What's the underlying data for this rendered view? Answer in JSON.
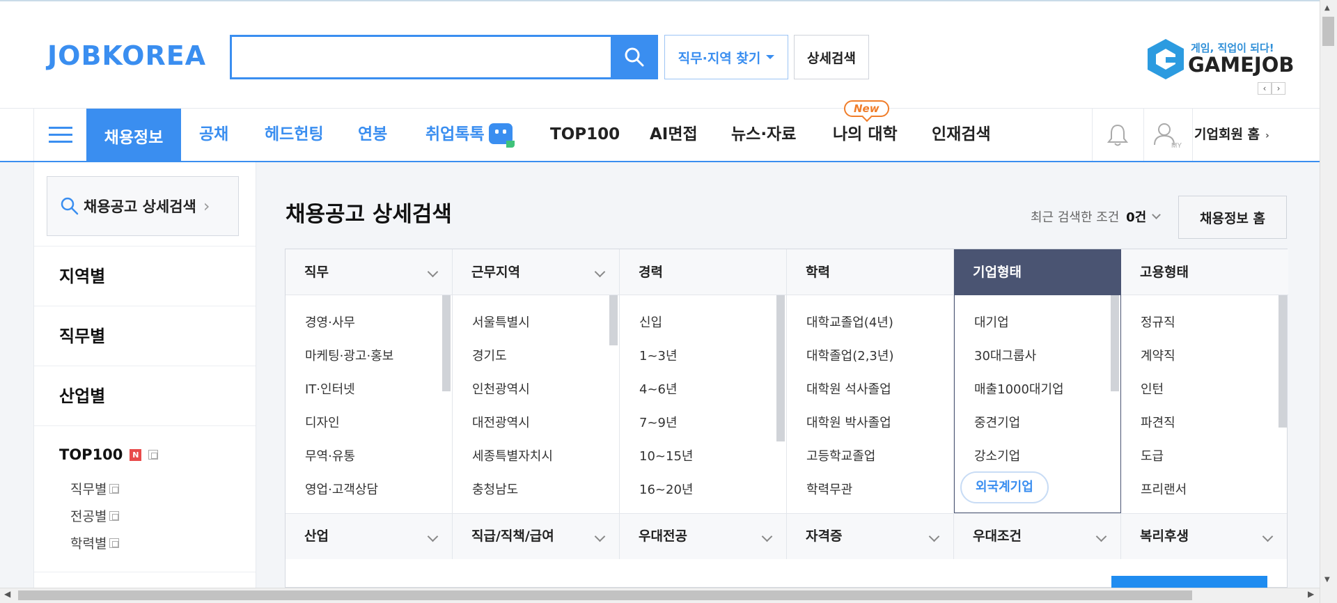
{
  "header": {
    "logo": "JOBKOREA",
    "search_value": "",
    "find_button": "직무·지역 찾기",
    "detail_button": "상세검색",
    "gamejob_slogan": "게임, 직업이 되다!",
    "gamejob_logo": "GAMEJOB"
  },
  "nav": {
    "items": [
      "채용정보",
      "공채",
      "헤드헌팅",
      "연봉",
      "취업톡톡",
      "TOP100",
      "AI면접",
      "뉴스·자료",
      "나의 대학",
      "인재검색"
    ],
    "new_badge": "New",
    "my_label": "MY",
    "business_home": "기업회원 홈"
  },
  "sidebar": {
    "search_label": "채용공고 상세검색",
    "sections": [
      "지역별",
      "직무별",
      "산업별"
    ],
    "top100": "TOP100",
    "top100_badge": "N",
    "top100_sub": [
      "직무별",
      "전공별",
      "학력별"
    ]
  },
  "main": {
    "title": "채용공고 상세검색",
    "recent_prefix": "최근 검색한 조건",
    "recent_count": "0건",
    "home_button": "채용정보 홈"
  },
  "filters": {
    "columns": [
      {
        "name": "직무",
        "options": [
          "경영·사무",
          "마케팅·광고·홍보",
          "IT·인터넷",
          "디자인",
          "무역·유통",
          "영업·고객상담"
        ]
      },
      {
        "name": "근무지역",
        "options": [
          "서울특별시",
          "경기도",
          "인천광역시",
          "대전광역시",
          "세종특별자치시",
          "충청남도"
        ]
      },
      {
        "name": "경력",
        "options": [
          "신입",
          "1~3년",
          "4~6년",
          "7~9년",
          "10~15년",
          "16~20년"
        ]
      },
      {
        "name": "학력",
        "options": [
          "대학교졸업(4년)",
          "대학졸업(2,3년)",
          "대학원 석사졸업",
          "대학원 박사졸업",
          "고등학교졸업",
          "학력무관"
        ]
      },
      {
        "name": "기업형태",
        "options": [
          "대기업",
          "30대그룹사",
          "매출1000대기업",
          "중견기업",
          "강소기업"
        ],
        "selected": "외국계기업"
      },
      {
        "name": "고용형태",
        "options": [
          "정규직",
          "계약직",
          "인턴",
          "파견직",
          "도급",
          "프리랜서"
        ]
      }
    ],
    "row2": [
      "산업",
      "직급/직책/급여",
      "우대전공",
      "자격증",
      "우대조건",
      "복리후생"
    ]
  },
  "colors": {
    "brand": "#3a8ef0",
    "active_tab": "#4a5472",
    "new_badge": "#f07d2a"
  }
}
